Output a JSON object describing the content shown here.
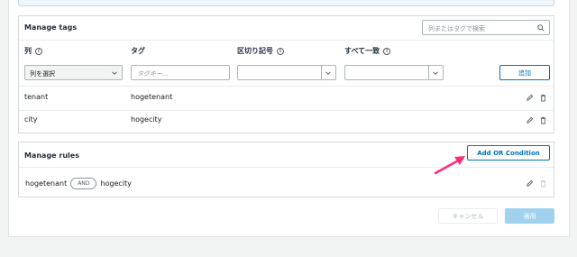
{
  "manage_tags": {
    "title": "Manage tags",
    "search_placeholder": "列またはタグで検索",
    "columns": [
      "列",
      "タグ",
      "区切り記号",
      "すべて一致"
    ],
    "column_select_value": "列を選択",
    "tag_placeholder": "タグキー...",
    "add_label": "追加",
    "rows": [
      {
        "column": "tenant",
        "tag": "hogetenant"
      },
      {
        "column": "city",
        "tag": "hogecity"
      }
    ]
  },
  "manage_rules": {
    "title": "Manage rules",
    "add_or_label": "Add OR Condition",
    "rule": {
      "left": "hogetenant",
      "operator": "AND",
      "right": "hogecity"
    }
  },
  "footer": {
    "cancel_label": "キャンセル",
    "apply_label": "適用"
  },
  "colors": {
    "accent": "#0073bb",
    "annotation_arrow": "#ff2a7a"
  }
}
